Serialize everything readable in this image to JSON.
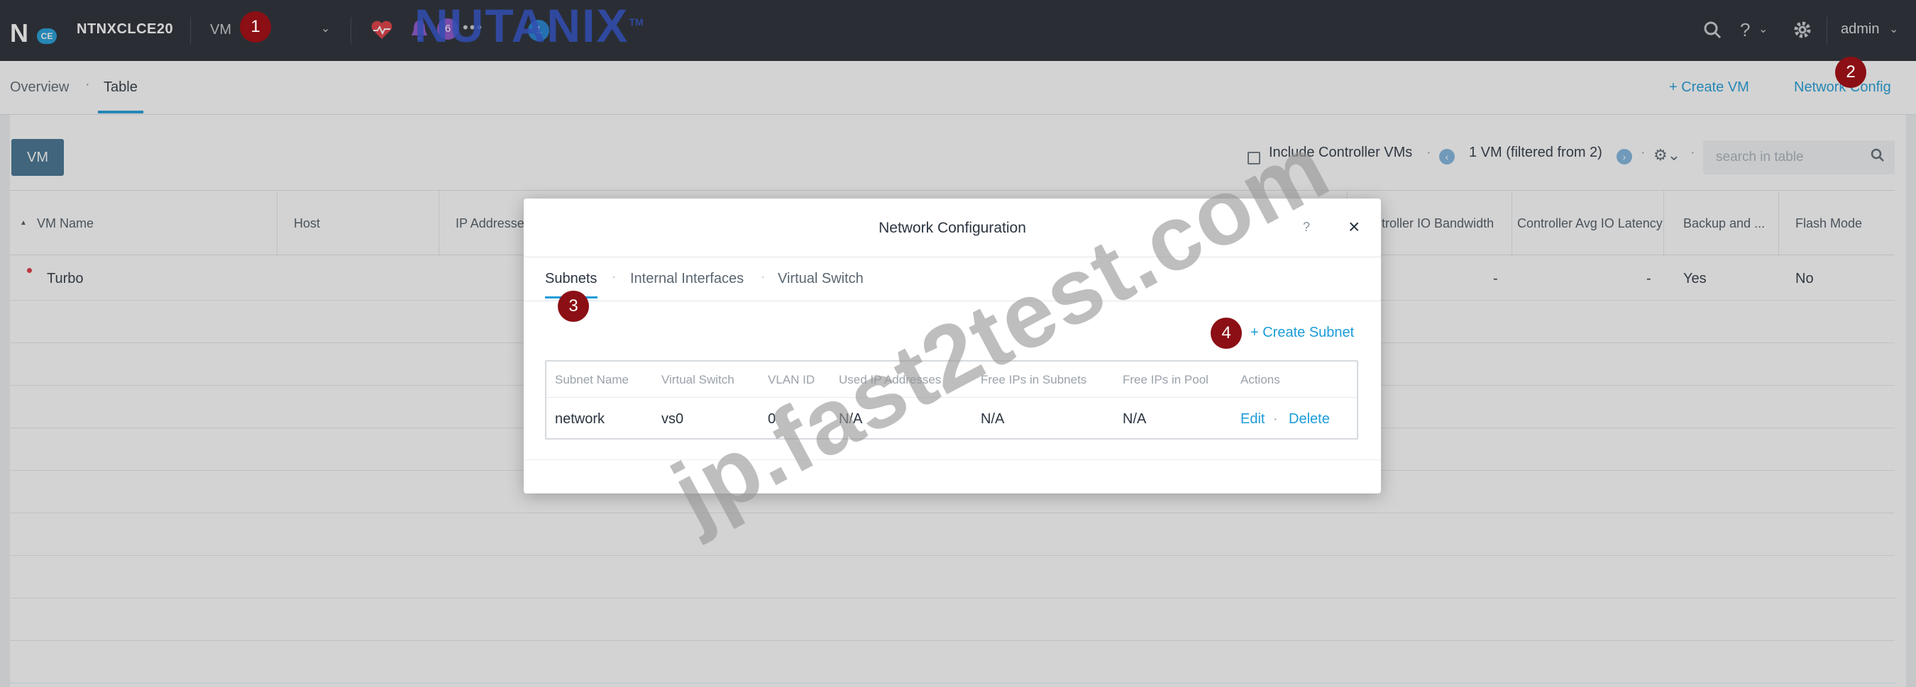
{
  "topbar": {
    "logo_letter": "N",
    "logo_badge": "CE",
    "cluster_name": "NTNXCLCE20",
    "nav_selected": "VM",
    "alert_count": "6",
    "info_count": "1",
    "brand_name": "NUTANIX",
    "brand_tm": "TM",
    "admin_label": "admin"
  },
  "subnav": {
    "tabs": [
      {
        "label": "Overview"
      },
      {
        "label": "Table"
      }
    ],
    "create_vm": "+ Create VM",
    "network_config": "Network Config"
  },
  "toolbar": {
    "vm_button": "VM",
    "include_controller": "Include Controller VMs",
    "vm_count": "1 VM (filtered from 2)",
    "search_placeholder": "search in table"
  },
  "table": {
    "columns": [
      "VM Name",
      "Host",
      "IP Addresses",
      "Controller IO Bandwidth",
      "Controller Avg IO Latency",
      "Backup and ...",
      "Flash Mode"
    ],
    "rows": [
      {
        "vm_name": "Turbo",
        "controller_io_bandwidth": "-",
        "controller_avg_io_latency": "-",
        "backup": "Yes",
        "flash_mode": "No"
      }
    ]
  },
  "modal": {
    "title": "Network Configuration",
    "help": "?",
    "close": "×",
    "tabs": [
      {
        "label": "Subnets"
      },
      {
        "label": "Internal Interfaces"
      },
      {
        "label": "Virtual Switch"
      }
    ],
    "create_subnet": "+ Create Subnet",
    "subnet_columns": [
      "Subnet Name",
      "Virtual Switch",
      "VLAN ID",
      "Used IP Addresses",
      "Free IPs in Subnets",
      "Free IPs in Pool",
      "Actions"
    ],
    "subnet_rows": [
      {
        "name": "network",
        "virtual_switch": "vs0",
        "vlan_id": "0",
        "used_ips": "N/A",
        "free_subnets": "N/A",
        "free_pool": "N/A",
        "edit": "Edit",
        "sep": "·",
        "delete": "Delete"
      }
    ]
  },
  "annotations": [
    "1",
    "2",
    "3",
    "4"
  ],
  "watermark": "jp.fast2test.com",
  "colors": {
    "topbar": "#22272e",
    "accent": "#1b9cd8",
    "marker": "#8b0f14",
    "vm_button": "#3f6f8f"
  }
}
